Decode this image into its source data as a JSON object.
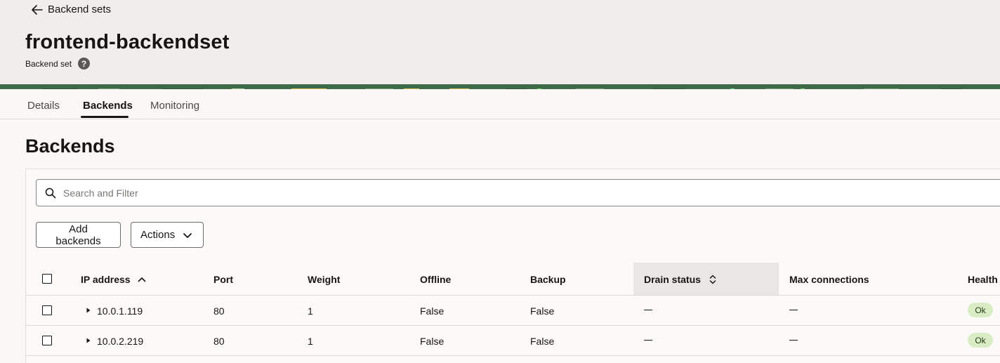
{
  "header": {
    "back_label": "Backend sets",
    "title": "frontend-backendset",
    "subtitle": "Backend set",
    "help_icon": "help-icon"
  },
  "tabs": [
    {
      "label": "Details",
      "active": false
    },
    {
      "label": "Backends",
      "active": true
    },
    {
      "label": "Monitoring",
      "active": false
    }
  ],
  "section": {
    "title": "Backends"
  },
  "search": {
    "placeholder": "Search and Filter",
    "value": ""
  },
  "toolbar": {
    "add_label": "Add backends",
    "actions_label": "Actions"
  },
  "table": {
    "columns": [
      "IP address",
      "Port",
      "Weight",
      "Offline",
      "Backup",
      "Drain status",
      "Max connections",
      "Health"
    ],
    "sort": {
      "column": "IP address",
      "direction": "ascending"
    },
    "rows": [
      {
        "ip": "10.0.1.119",
        "port": "80",
        "weight": "1",
        "offline": "False",
        "backup": "False",
        "drain": "—",
        "max_connections": "—",
        "health": "Ok"
      },
      {
        "ip": "10.0.2.219",
        "port": "80",
        "weight": "1",
        "offline": "False",
        "backup": "False",
        "drain": "—",
        "max_connections": "—",
        "health": "Ok"
      }
    ]
  },
  "colors": {
    "header_bg": "#efeeec",
    "page_bg": "#f9f8f6",
    "health_ok_bg": "#d9ecc4",
    "banner_green": "#3f6a48"
  }
}
